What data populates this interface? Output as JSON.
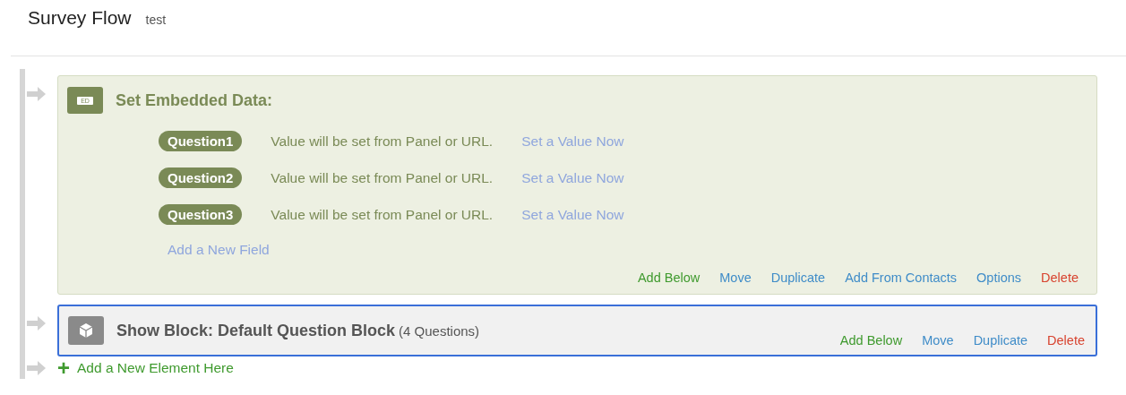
{
  "header": {
    "title": "Survey Flow",
    "subtitle": "test"
  },
  "elements": [
    {
      "kind": "embedded_data",
      "selected": false,
      "icon_label": "ED",
      "title": "Set Embedded Data:",
      "fields": [
        {
          "name": "Question1",
          "value": "Value will be set from Panel or URL.",
          "action": "Set a Value Now"
        },
        {
          "name": "Question2",
          "value": "Value will be set from Panel or URL.",
          "action": "Set a Value Now"
        },
        {
          "name": "Question3",
          "value": "Value will be set from Panel or URL.",
          "action": "Set a Value Now"
        }
      ],
      "add_field": "Add a New Field",
      "actions": [
        {
          "label": "Add Below",
          "kind": "add"
        },
        {
          "label": "Move",
          "kind": "normal"
        },
        {
          "label": "Duplicate",
          "kind": "normal"
        },
        {
          "label": "Add From Contacts",
          "kind": "normal"
        },
        {
          "label": "Options",
          "kind": "normal"
        },
        {
          "label": "Delete",
          "kind": "delete"
        }
      ]
    },
    {
      "kind": "block",
      "selected": true,
      "title": "Show Block: Default Question Block",
      "count": "(4 Questions)",
      "actions": [
        {
          "label": "Add Below",
          "kind": "add"
        },
        {
          "label": "Move",
          "kind": "normal"
        },
        {
          "label": "Duplicate",
          "kind": "normal"
        },
        {
          "label": "Delete",
          "kind": "delete"
        }
      ]
    }
  ],
  "add_element": {
    "icon": "+",
    "label": "Add a New Element Here"
  }
}
